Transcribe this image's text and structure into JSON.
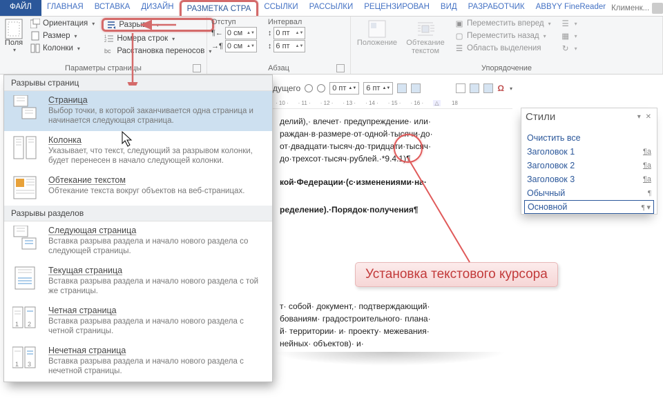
{
  "tabs": {
    "file": "ФАЙЛ",
    "home": "ГЛАВНАЯ",
    "insert": "ВСТАВКА",
    "design": "ДИЗАЙН",
    "layout": "РАЗМЕТКА СТРА",
    "refs": "ССЫЛКИ",
    "mail": "РАССЫЛКИ",
    "review": "РЕЦЕНЗИРОВАН",
    "view": "ВИД",
    "dev": "РАЗРАБОТЧИК",
    "abbyy": "ABBYY FineReader",
    "user": "Клименк..."
  },
  "groups": {
    "page_setup": "Параметры страницы",
    "paragraph": "Абзац",
    "arrange": "Упорядочение"
  },
  "page_setup": {
    "margins": "Поля",
    "orientation": "Ориентация",
    "size": "Размер",
    "columns": "Колонки",
    "breaks": "Разрывы",
    "line_numbers": "Номера строк",
    "hyphenation": "Расстановка переносов"
  },
  "para": {
    "indent_label": "Отступ",
    "spacing_label": "Интервал",
    "left": "0 см",
    "right": "0 см",
    "before": "0 пт",
    "after": "6 пт"
  },
  "arrange": {
    "position": "Положение",
    "wrap": "Обтекание текстом",
    "bring_forward": "Переместить вперед",
    "send_backward": "Переместить назад",
    "selection_pane": "Область выделения"
  },
  "dropdown": {
    "hdr1": "Разрывы страниц",
    "hdr2": "Разрывы разделов",
    "page_t": "Страница",
    "page_d": "Выбор точки, в которой заканчивается одна страница и начинается следующая страница.",
    "col_t": "Колонка",
    "col_d": "Указывает, что текст, следующий за разрывом колонки, будет перенесен в начало следующей колонки.",
    "wrap_t": "Обтекание текстом",
    "wrap_d": "Обтекание текста вокруг объектов на веб-страницах.",
    "next_t": "Следующая страница",
    "next_d": "Вставка разрыва раздела и начало нового раздела со следующей страницы.",
    "cur_t": "Текущая страница",
    "cur_d": "Вставка разрыва раздела и начало нового раздела с той же страницы.",
    "even_t": "Четная страница",
    "even_d": "Вставка разрыва раздела и начало нового раздела с четной страницы.",
    "odd_t": "Нечетная страница",
    "odd_d": "Вставка разрыва раздела и начало нового раздела с нечетной страницы."
  },
  "doc": {
    "l1": "делий),· влечет· предупреждение· или·",
    "l2": "раждан·в·размере·от·одной·тысячи·до·",
    "l3": "от·двадцати·тысяч·до·тридцати·тысяч·",
    "l4": "до·трехсот·тысяч·рублей.·*9.4.1)¶",
    "l5": "кой·Федерации·(с·изменениями·на·",
    "l6": "ределение).·Порядок·получения¶",
    "l7": "т· собой· документ,· подтверждающий·",
    "l8": "бованиям· градостроительного· плана·",
    "l9": "й· территории· и· проекту· межевания·",
    "l10": "нейных· объектов)· и·"
  },
  "subbar": {
    "before": "0 пт",
    "after": "6 пт",
    "prev": "дущего"
  },
  "ruler": [
    "10",
    "11",
    "12",
    "13",
    "14",
    "15",
    "16",
    "",
    "18"
  ],
  "callout": "Установка текстового курсора",
  "styles": {
    "title": "Стили",
    "clear": "Очистить все",
    "h1": "Заголовок 1",
    "h2": "Заголовок 2",
    "h3": "Заголовок 3",
    "normal": "Обычный",
    "main": "Основной"
  }
}
